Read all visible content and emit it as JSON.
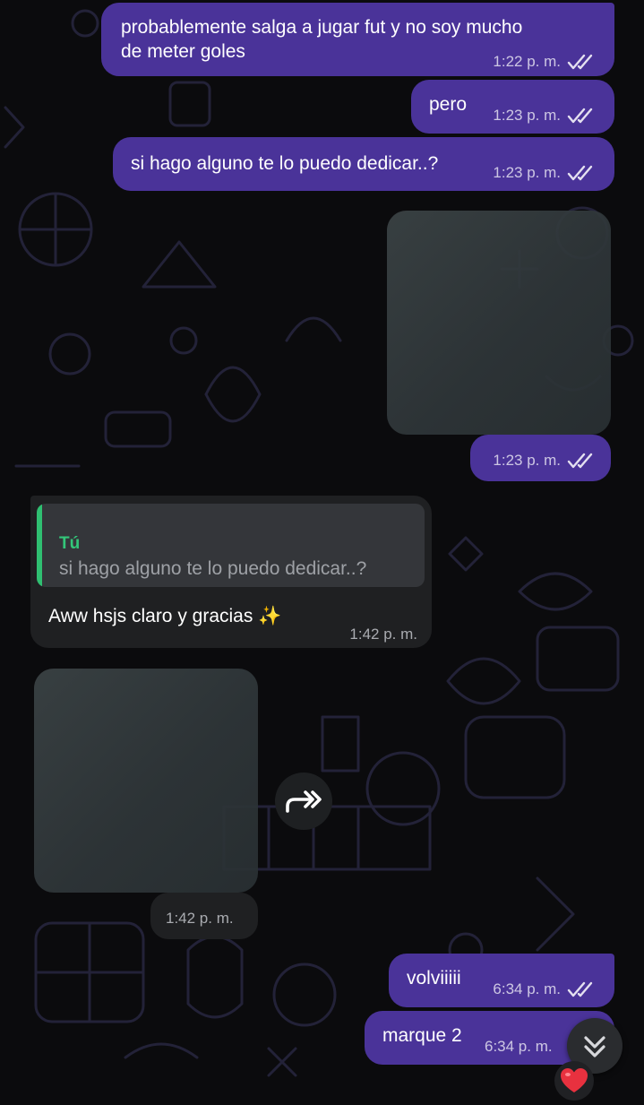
{
  "theme": {
    "outgoing_bubble": "#4a3399",
    "incoming_bubble": "#1f2022",
    "quote_accent": "#2fbf71"
  },
  "messages": [
    {
      "line1": "probablemente salga a jugar fut y no soy mucho",
      "line2": "de meter goles",
      "time": "1:22 p. m."
    },
    {
      "text": "pero",
      "time": "1:23 p. m."
    },
    {
      "text": "si hago alguno te lo puedo dedicar..?",
      "time": "1:23 p. m."
    },
    {
      "type": "image",
      "time": "1:23 p. m."
    },
    {
      "quote_author": "Tú",
      "quote_text": "si hago alguno te lo puedo dedicar..?",
      "text": "Aww hsjs claro y gracias ✨",
      "time": "1:42 p. m."
    },
    {
      "type": "image",
      "time": "1:42 p. m."
    },
    {
      "text": "volviiiii",
      "time": "6:34 p. m."
    },
    {
      "text": "marque 2",
      "time": "6:34 p. m."
    }
  ],
  "reaction": {
    "emoji": "❤️"
  },
  "icons": {
    "read_receipt": "double-check-icon",
    "forward": "forward-icon",
    "scroll_down": "chevron-double-down-icon"
  }
}
